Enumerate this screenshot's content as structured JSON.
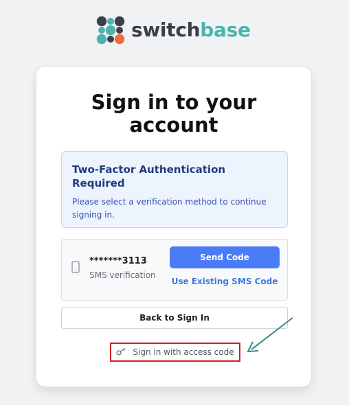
{
  "brand": {
    "name_part1": "switch",
    "name_part2": "base",
    "colors": {
      "dark": "#3c4048",
      "teal": "#4fb2ad",
      "orange": "#f26a3d"
    }
  },
  "signin": {
    "title": "Sign in to your account"
  },
  "notice": {
    "title": "Two-Factor Authentication Required",
    "text": "Please select a verification method to continue signing in."
  },
  "method": {
    "icon": "mobile-phone-icon",
    "masked_number": "*******3113",
    "type_label": "SMS verification",
    "send_label": "Send Code",
    "use_existing_label": "Use Existing SMS Code"
  },
  "actions": {
    "back_label": "Back to Sign In",
    "access_code_label": "Sign in with access code",
    "access_code_icon": "key-icon"
  },
  "colors": {
    "primary": "#4a7cf7",
    "highlight_box": "#d01f28",
    "arrow": "#2e8a7e"
  }
}
